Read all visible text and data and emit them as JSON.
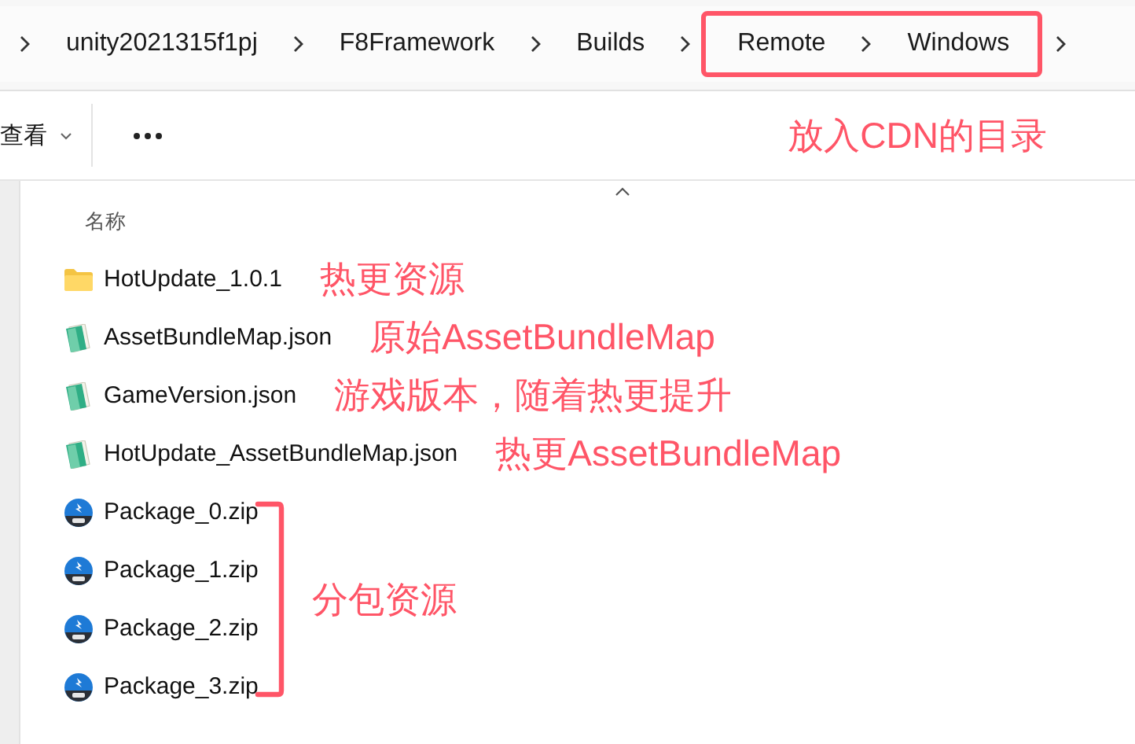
{
  "breadcrumb": {
    "items": [
      {
        "label": "unity2021315f1pj",
        "highlighted": false
      },
      {
        "label": "F8Framework",
        "highlighted": false
      },
      {
        "label": "Builds",
        "highlighted": false
      },
      {
        "label": "Remote",
        "highlighted": true
      },
      {
        "label": "Windows",
        "highlighted": true
      }
    ]
  },
  "toolbar": {
    "view_button": "查看",
    "note": "放入CDN的目录"
  },
  "file_list": {
    "column": "名称",
    "files": [
      {
        "name": "HotUpdate_1.0.1",
        "kind": "folder",
        "note": "热更资源",
        "bracketed": false
      },
      {
        "name": "AssetBundleMap.json",
        "kind": "json",
        "note": "原始AssetBundleMap",
        "bracketed": false
      },
      {
        "name": "GameVersion.json",
        "kind": "json",
        "note": "游戏版本，随着热更提升",
        "bracketed": false
      },
      {
        "name": "HotUpdate_AssetBundleMap.json",
        "kind": "json",
        "note": "热更AssetBundleMap",
        "bracketed": false
      },
      {
        "name": "Package_0.zip",
        "kind": "zip",
        "bracketed": true
      },
      {
        "name": "Package_1.zip",
        "kind": "zip",
        "bracketed": true
      },
      {
        "name": "Package_2.zip",
        "kind": "zip",
        "bracketed": true
      },
      {
        "name": "Package_3.zip",
        "kind": "zip",
        "bracketed": true
      }
    ],
    "bracket_note": "分包资源"
  }
}
